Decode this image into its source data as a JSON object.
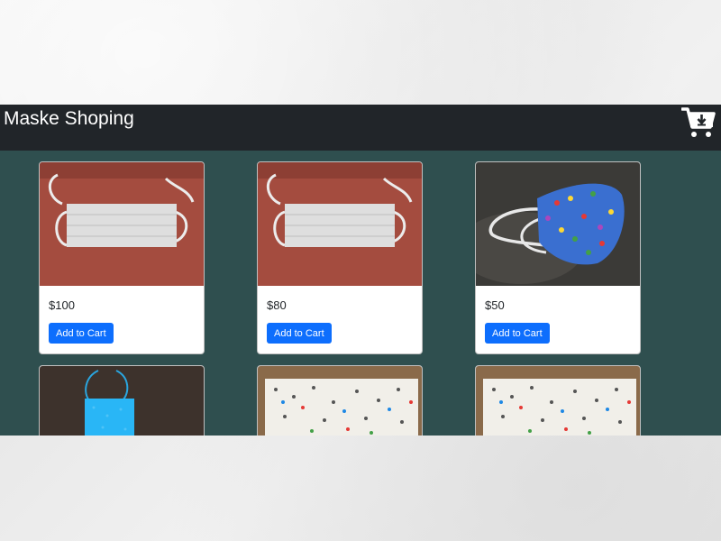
{
  "navbar": {
    "brand": "Maske Shoping",
    "cart_icon": "cart-download-icon"
  },
  "products": [
    {
      "price": "$100",
      "button_label": "Add to Cart",
      "image": "white-dotted-mask-on-red-table"
    },
    {
      "price": "$80",
      "button_label": "Add to Cart",
      "image": "white-dotted-mask-on-red-table"
    },
    {
      "price": "$50",
      "button_label": "Add to Cart",
      "image": "blue-heart-print-mask"
    },
    {
      "price": "",
      "button_label": "",
      "image": "light-blue-mask-on-wood"
    },
    {
      "price": "",
      "button_label": "",
      "image": "multicolor-dot-mask"
    },
    {
      "price": "",
      "button_label": "",
      "image": "multicolor-dot-mask"
    }
  ],
  "colors": {
    "navbar_bg": "#212529",
    "page_bg": "#2f4f4f",
    "button_bg": "#0d6efd"
  }
}
